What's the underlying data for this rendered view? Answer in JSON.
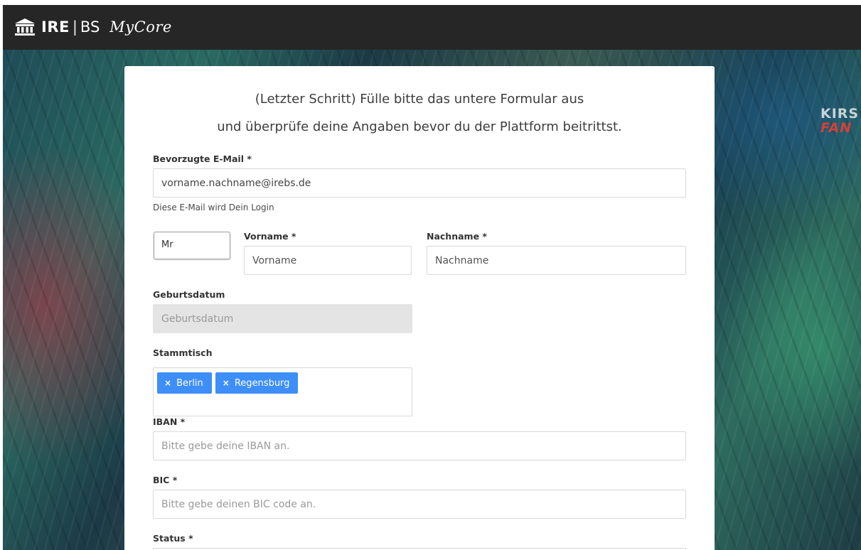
{
  "app": {
    "logo_ire": "IRE",
    "logo_sep": "|",
    "logo_bs": "BS",
    "logo_mycore": "MyCore"
  },
  "background": {
    "sign_line1": "KIRS",
    "sign_line2": "FAN"
  },
  "form": {
    "intro_line1": "(Letzter Schritt) Fülle bitte das untere Formular aus",
    "intro_line2": "und überprüfe deine Angaben bevor du der Plattform beitrittst.",
    "email": {
      "label": "Bevorzugte E-Mail *",
      "value": "vorname.nachname@irebs.de",
      "help": "Diese E-Mail wird Dein Login"
    },
    "salutation": {
      "value": "Mr"
    },
    "firstname": {
      "label": "Vorname *",
      "placeholder": "Vorname"
    },
    "lastname": {
      "label": "Nachname *",
      "placeholder": "Nachname"
    },
    "birthdate": {
      "label": "Geburtsdatum",
      "placeholder": "Geburtsdatum"
    },
    "stammtisch": {
      "label": "Stammtisch",
      "tags": [
        {
          "remove": "×",
          "label": "Berlin"
        },
        {
          "remove": "×",
          "label": "Regensburg"
        }
      ]
    },
    "iban": {
      "label": "IBAN *",
      "placeholder": "Bitte gebe deine IBAN an."
    },
    "bic": {
      "label": "BIC *",
      "placeholder": "Bitte gebe deinen BIC code an."
    },
    "status": {
      "label": "Status *"
    }
  },
  "colors": {
    "topbar": "#262626",
    "tag": "#3e8ef7",
    "disabled_field": "#e4e4e4"
  }
}
